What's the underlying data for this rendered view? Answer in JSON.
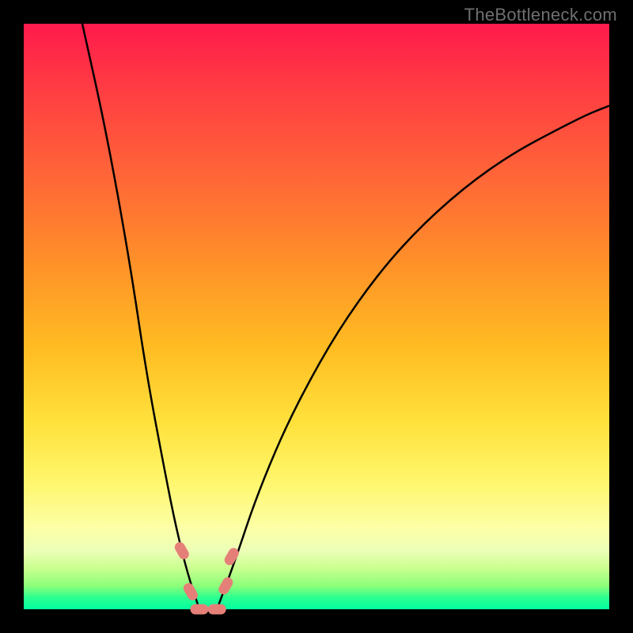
{
  "watermark": "TheBottleneck.com",
  "chart_data": {
    "type": "line",
    "title": "",
    "xlabel": "",
    "ylabel": "",
    "xlim": [
      0,
      100
    ],
    "ylim": [
      0,
      100
    ],
    "background": "gradient red→green (bottleneck severity map)",
    "series": [
      {
        "name": "curve-left",
        "description": "left descending branch of V-curve",
        "x": [
          10,
          14,
          18,
          21,
          24,
          26,
          28,
          30
        ],
        "y": [
          100,
          82,
          60,
          40,
          24,
          14,
          6,
          0
        ]
      },
      {
        "name": "curve-right",
        "description": "right ascending branch of V-curve",
        "x": [
          33,
          36,
          40,
          46,
          55,
          66,
          80,
          95,
          100
        ],
        "y": [
          0,
          8,
          20,
          34,
          50,
          64,
          76,
          84,
          86
        ]
      }
    ],
    "annotations": [
      {
        "name": "marker-left-upper",
        "x": 27,
        "y": 10,
        "shape": "pill"
      },
      {
        "name": "marker-left-lower",
        "x": 28.5,
        "y": 3,
        "shape": "pill"
      },
      {
        "name": "marker-trough-left",
        "x": 30,
        "y": 0,
        "shape": "pill"
      },
      {
        "name": "marker-trough-right",
        "x": 33,
        "y": 0,
        "shape": "pill"
      },
      {
        "name": "marker-right-lower",
        "x": 34.5,
        "y": 4,
        "shape": "pill"
      },
      {
        "name": "marker-right-upper",
        "x": 35.5,
        "y": 9,
        "shape": "pill"
      }
    ]
  }
}
